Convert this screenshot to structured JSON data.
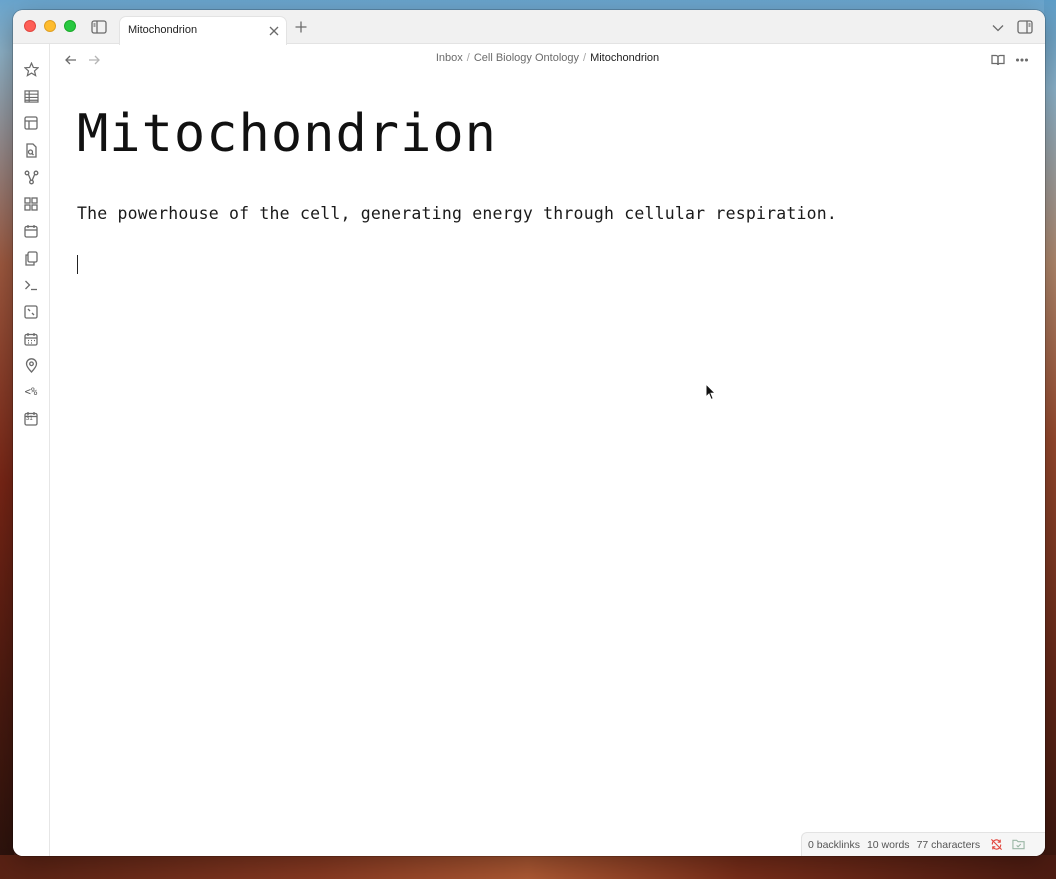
{
  "tab": {
    "title": "Mitochondrion"
  },
  "breadcrumb": {
    "items": [
      "Inbox",
      "Cell Biology Ontology"
    ],
    "current": "Mitochondrion",
    "separator": "/"
  },
  "note": {
    "title": "Mitochondrion",
    "body": "The powerhouse of the cell, generating energy through cellular respiration."
  },
  "status": {
    "backlinks": "0 backlinks",
    "words": "10 words",
    "characters": "77 characters"
  },
  "ribbon": {
    "icons": [
      "star-icon",
      "table-icon",
      "layout-icon",
      "file-search-icon",
      "graph-icon",
      "blocks-icon",
      "calendar-icon",
      "copy-icon",
      "terminal-icon",
      "canvas-icon",
      "calendar-grid-icon",
      "map-pin-icon",
      "templater-icon",
      "calendar-31-icon"
    ],
    "templater_glyph": "<%",
    "calendar_day": "31"
  },
  "colors": {
    "accent": "#7c5cff",
    "sync_error": "#e2453c"
  }
}
